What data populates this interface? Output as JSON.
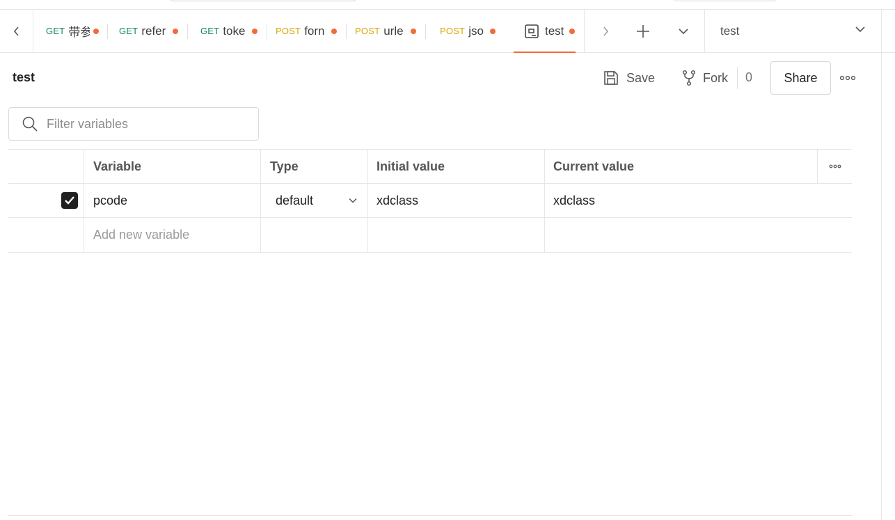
{
  "tabs": [
    {
      "method": "GET",
      "name": "带参",
      "unsaved": true
    },
    {
      "method": "GET",
      "name": "refer",
      "unsaved": true
    },
    {
      "method": "GET",
      "name": "toke",
      "unsaved": true
    },
    {
      "method": "POST",
      "name": "forn",
      "unsaved": true
    },
    {
      "method": "POST",
      "name": "urle",
      "unsaved": true
    },
    {
      "method": "POST",
      "name": "jso",
      "unsaved": true
    },
    {
      "method": "",
      "name": "test",
      "unsaved": true,
      "active": true
    }
  ],
  "environment": {
    "selected": "test"
  },
  "header": {
    "title": "test",
    "save_label": "Save",
    "fork_label": "Fork",
    "fork_count": "0",
    "share_label": "Share"
  },
  "filter": {
    "placeholder": "Filter variables"
  },
  "table": {
    "columns": [
      "Variable",
      "Type",
      "Initial value",
      "Current value"
    ],
    "rows": [
      {
        "enabled": true,
        "variable": "pcode",
        "type": "default",
        "initial_value": "xdclass",
        "current_value": "xdclass"
      }
    ],
    "add_placeholder": "Add new variable"
  },
  "colors": {
    "accent": "#f26b3a",
    "get_method": "#0f8a5f",
    "post_method": "#d9a600"
  },
  "icons": [
    "chevron-left-icon",
    "environment-icon",
    "chevron-right-icon",
    "plus-icon",
    "chevron-down-icon",
    "save-icon",
    "fork-icon",
    "more-horizontal-icon",
    "search-icon",
    "checkmark-icon"
  ]
}
